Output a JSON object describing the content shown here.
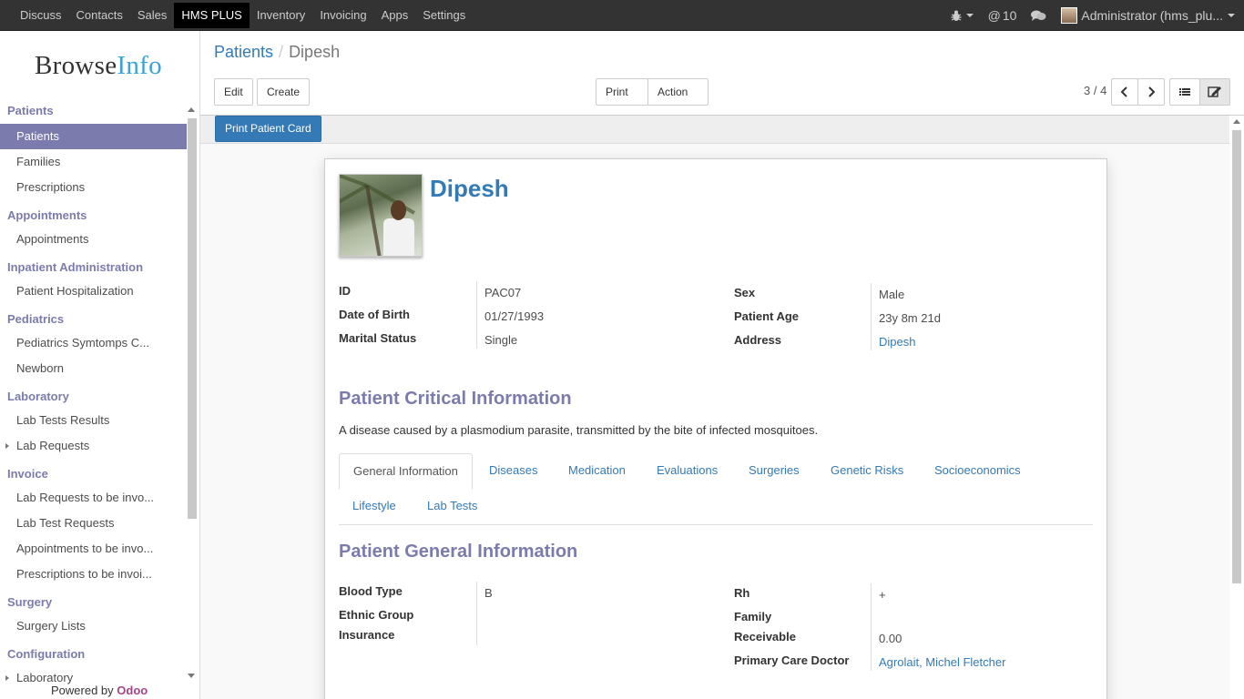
{
  "topbar": {
    "apps": [
      "Discuss",
      "Contacts",
      "Sales",
      "HMS PLUS",
      "Inventory",
      "Invoicing",
      "Apps",
      "Settings"
    ],
    "active_app": "HMS PLUS",
    "mention_count": "10",
    "user": "Administrator (hms_plu..."
  },
  "sidebar": {
    "logo_browse": "Browse",
    "logo_info": "Info",
    "sections": [
      {
        "title": "Patients",
        "items": [
          "Patients",
          "Families",
          "Prescriptions"
        ]
      },
      {
        "title": "Appointments",
        "items": [
          "Appointments"
        ]
      },
      {
        "title": "Inpatient Administration",
        "items": [
          "Patient Hospitalization"
        ]
      },
      {
        "title": "Pediatrics",
        "items": [
          "Pediatrics Symtomps C...",
          "Newborn"
        ]
      },
      {
        "title": "Laboratory",
        "items": [
          "Lab Tests Results",
          "Lab Requests"
        ]
      },
      {
        "title": "Invoice",
        "items": [
          "Lab Requests to be invo...",
          "Lab Test Requests",
          "Appointments to be invo...",
          "Prescriptions to be invoi..."
        ]
      },
      {
        "title": "Surgery",
        "items": [
          "Surgery Lists"
        ]
      },
      {
        "title": "Configuration",
        "items": [
          "Laboratory"
        ]
      }
    ],
    "active_item": "Patients",
    "powered_by": "Powered by",
    "powered_brand": "Odoo"
  },
  "control_panel": {
    "breadcrumb_parent": "Patients",
    "breadcrumb_sep": "/",
    "breadcrumb_current": "Dipesh",
    "edit_label": "Edit",
    "create_label": "Create",
    "print_label": "Print",
    "action_label": "Action",
    "pager": "3 / 4"
  },
  "statusbar": {
    "print_card_label": "Print Patient Card"
  },
  "patient": {
    "name": "Dipesh",
    "fields_left": [
      {
        "label": "ID",
        "value": "PAC07"
      },
      {
        "label": "Date of Birth",
        "value": "01/27/1993"
      },
      {
        "label": "Marital Status",
        "value": "Single"
      }
    ],
    "fields_right": [
      {
        "label": "Sex",
        "value": "Male"
      },
      {
        "label": "Patient Age",
        "value": "23y 8m 21d"
      },
      {
        "label": "Address",
        "value": "Dipesh"
      }
    ],
    "critical_title": "Patient Critical Information",
    "critical_text": "A disease caused by a plasmodium parasite, transmitted by the bite of infected mosquitoes.",
    "tabs": [
      "General Information",
      "Diseases",
      "Medication",
      "Evaluations",
      "Surgeries",
      "Genetic Risks",
      "Socioeconomics",
      "Lifestyle",
      "Lab Tests"
    ],
    "active_tab": "General Information",
    "general_title": "Patient General Information",
    "general_left": [
      {
        "label": "Blood Type",
        "value": "B"
      },
      {
        "label": "Ethnic Group",
        "value": ""
      },
      {
        "label": "Insurance",
        "value": ""
      }
    ],
    "general_right": [
      {
        "label": "Rh",
        "value": "+"
      },
      {
        "label": "Family",
        "value": ""
      },
      {
        "label": "Receivable",
        "value": "0.00"
      },
      {
        "label": "Primary Care Doctor",
        "value": "Agrolait, Michel Fletcher"
      }
    ]
  }
}
